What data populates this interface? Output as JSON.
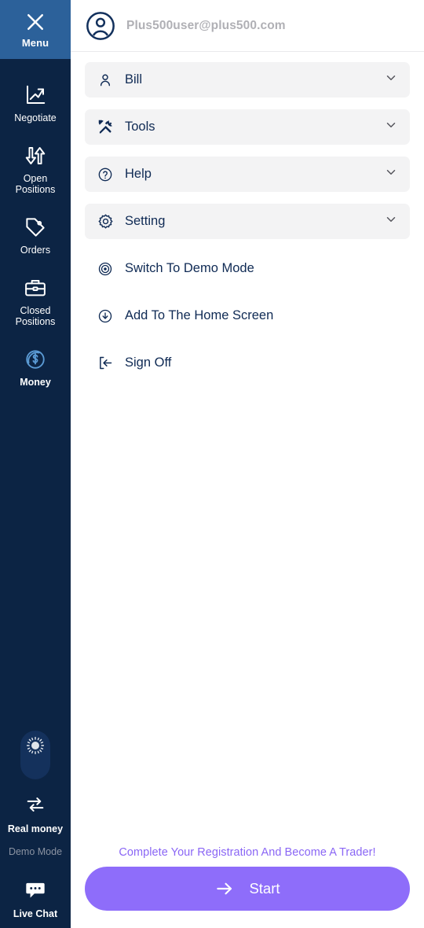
{
  "sidebar": {
    "menu_header": {
      "label": "Menu",
      "icon": "close-icon"
    },
    "items": [
      {
        "label": "Negotiate",
        "icon": "chart-line-icon",
        "active": false
      },
      {
        "label": "Open\nPositions",
        "line1": "Open",
        "line2": "Positions",
        "icon": "open-positions-icon",
        "active": false
      },
      {
        "label": "Orders",
        "icon": "tag-icon",
        "active": false
      },
      {
        "label": "Closed\nPositions",
        "line1": "Closed",
        "line2": "Positions",
        "icon": "briefcase-icon",
        "active": false
      },
      {
        "label": "Money",
        "icon": "coin-dollar-icon",
        "active": true
      }
    ],
    "theme_toggle": {
      "icon": "sun-icon"
    },
    "mode": {
      "real_money_label": "Real money",
      "real_money_icon": "swap-arrows-icon",
      "demo_mode_label": "Demo Mode"
    },
    "live_chat": {
      "label": "Live Chat",
      "icon": "chat-bubble-icon"
    }
  },
  "header": {
    "avatar_icon": "user-circle-icon",
    "email": "Plus500user@plus500.com"
  },
  "menu": {
    "expandable": [
      {
        "label": "Bill",
        "icon": "person-icon",
        "chevron": "chevron-down-icon"
      },
      {
        "label": "Tools",
        "icon": "tools-icon",
        "chevron": "chevron-down-icon"
      },
      {
        "label": "Help",
        "icon": "question-circle-icon",
        "chevron": "chevron-down-icon"
      },
      {
        "label": "Setting",
        "icon": "gear-icon",
        "chevron": "chevron-down-icon"
      }
    ],
    "actions": [
      {
        "label": "Switch To Demo Mode",
        "icon": "target-icon"
      },
      {
        "label": "Add To The Home Screen",
        "icon": "download-circle-icon"
      },
      {
        "label": "Sign Off",
        "icon": "sign-out-icon"
      }
    ]
  },
  "cta": {
    "text": "Complete Your Registration And Become A Trader!",
    "button_label": "Start",
    "button_icon": "arrow-right-icon",
    "button_color": "#8e6dfa",
    "text_color": "#8a66f5"
  },
  "colors": {
    "sidebar_navy": "#0c2444",
    "menu_header_blue": "#2c619a",
    "row_bg": "#f3f3f4",
    "navy_text": "#0f2a54",
    "accent_light_blue": "#5b9bd5"
  }
}
